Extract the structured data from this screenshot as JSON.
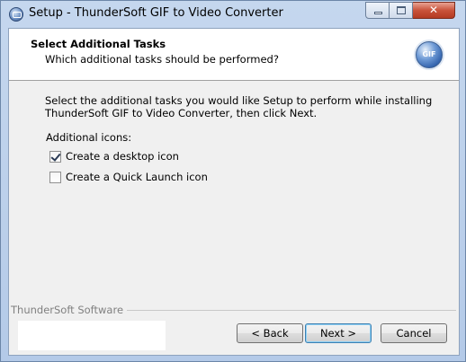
{
  "window": {
    "title": "Setup - ThunderSoft GIF to Video Converter",
    "close_glyph": "✕"
  },
  "header": {
    "title": "Select Additional Tasks",
    "subtitle": "Which additional tasks should be performed?",
    "badge_text": "GIF"
  },
  "body": {
    "description": "Select the additional tasks you would like Setup to perform while installing ThunderSoft GIF to Video Converter, then click Next.",
    "section_label": "Additional icons:",
    "tasks": [
      {
        "label": "Create a desktop icon",
        "checked": true
      },
      {
        "label": "Create a Quick Launch icon",
        "checked": false
      }
    ]
  },
  "footer": {
    "brand": "ThunderSoft Software",
    "back_label": "< Back",
    "next_label": "Next >",
    "cancel_label": "Cancel"
  },
  "colors": {
    "titlebar": "#c5d7ee",
    "close_button": "#c9533b",
    "default_button_border": "#3c7fb1"
  }
}
